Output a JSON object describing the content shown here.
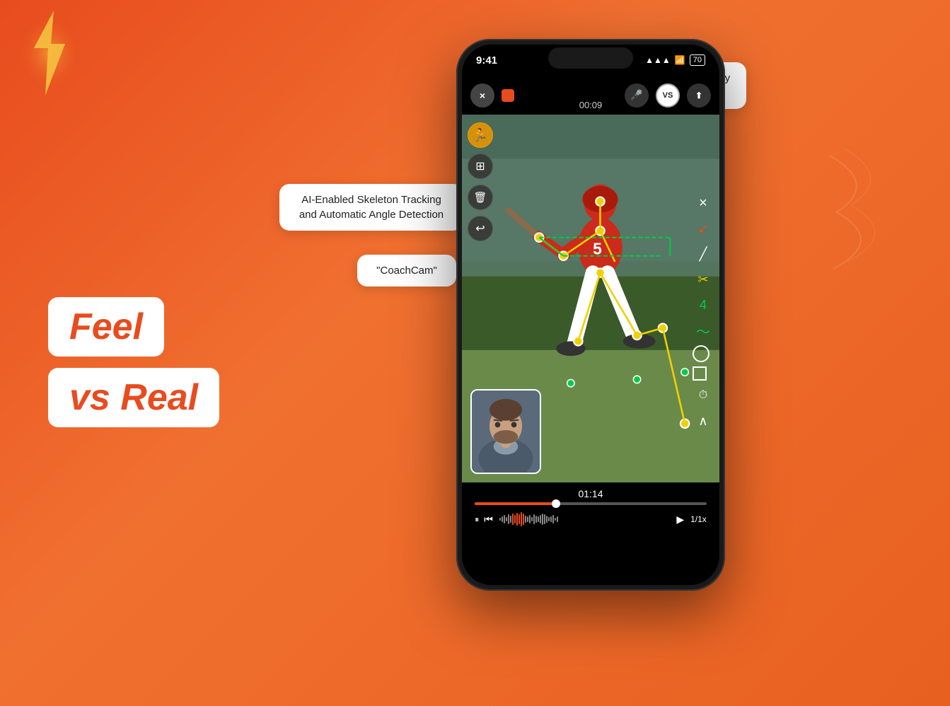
{
  "background": {
    "gradient_start": "#e84c1e",
    "gradient_end": "#e86020"
  },
  "labels": {
    "feel": "Feel",
    "vs_real": "vs Real"
  },
  "tooltips": {
    "versus": "Versus Mode and overlay two videos",
    "skeleton": "AI-Enabled Skeleton Tracking and Automatic Angle Detection",
    "coachcam": "\"CoachCam\""
  },
  "phone": {
    "status_bar": {
      "time": "9:41",
      "signal": "●●●",
      "wifi": "WiFi",
      "battery": "70"
    },
    "top_controls": {
      "close_label": "×",
      "mic_label": "🎤",
      "vs_label": "VS",
      "share_label": "⬆",
      "timer": "00:09"
    },
    "toolbar_left": {
      "skeleton_icon": "🏃",
      "target_icon": "⊞",
      "delete_icon": "🗑",
      "undo_icon": "↩"
    },
    "toolbar_right": {
      "close_icon": "×",
      "arrow_red_icon": "↙",
      "line_icon": "╱",
      "scissors_icon": "✂",
      "number_icon": "4",
      "curve_icon": "〜",
      "circle_icon": "○",
      "square_icon": "□",
      "timer_icon": "⏱",
      "chevron_icon": "∧"
    },
    "video": {
      "timestamp": "01:14"
    },
    "playback": {
      "speed": "1/1x",
      "pause_icon": "⏸",
      "rewind_icon": "⏮",
      "play_icon": "▶"
    }
  },
  "decorations": {
    "lightning_color": "#f5c842"
  }
}
